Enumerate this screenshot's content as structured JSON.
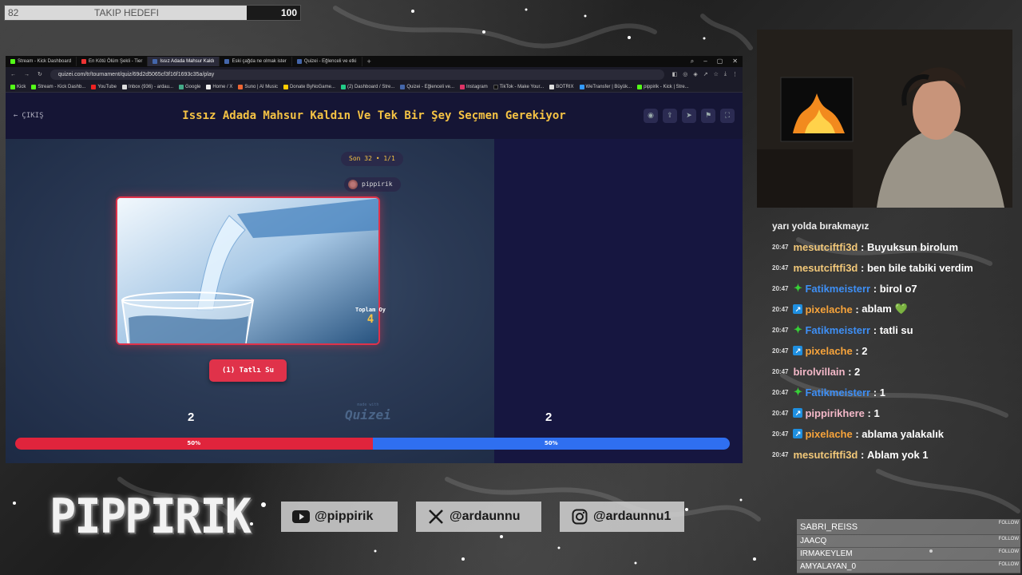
{
  "goal": {
    "current": "82",
    "label": "TAKIP HEDEFI",
    "max": "100",
    "progress": 0.82
  },
  "browser": {
    "tabs": [
      "Stream - Kick Dashboard",
      "En Kötü Ölüm Şekli - Tier",
      "Issız Adada Mahsur Kaldı",
      "Eski çağda ne olmak ister",
      "Quizei - Eğlenceli ve etki"
    ],
    "url": "quizei.com/tr/tournament/quiz/69d2d5065cf3f16f1693c35a/play",
    "bookmarks": [
      "Kick",
      "Stream - Kick Dashb...",
      "YouTube",
      "Inbox (936) - ardau...",
      "Google",
      "Home / X",
      "Suno | AI Music",
      "Donate ByNoGame...",
      "(2) Dashboard / Stre...",
      "Quizei - Eğlenceli ve...",
      "Instagram",
      "TikTok - Make Your...",
      "BOTRIX",
      "WeTransfer | Büyük...",
      "pippirik - Kick | Stre..."
    ]
  },
  "quiz": {
    "back_label": "ÇIKIŞ",
    "title": "Issız Adada Mahsur Kaldın Ve Tek Bir Şey Seçmen Gerekiyor",
    "round": "Son 32 • 1/1",
    "creator": "pippirik",
    "total_votes_label": "Toplam Oy",
    "total_votes": "4",
    "choice_label": "(1) Tatlı Su",
    "made_with": "made with",
    "brand": "Quizei",
    "left_count": "2",
    "right_count": "2",
    "left_percent": "50%",
    "right_percent": "50%"
  },
  "chat": {
    "cut_line": "yarı yolda bırakmayız",
    "messages": [
      {
        "time": "20:47",
        "badge": "",
        "user": "mesutciftfi3d",
        "color": "#f2c879",
        "text": "Buyuksun birolum"
      },
      {
        "time": "20:47",
        "badge": "",
        "user": "mesutciftfi3d",
        "color": "#f2c879",
        "text": "ben bile tabiki verdim"
      },
      {
        "time": "20:47",
        "badge": "green",
        "user": "Fatikmeisterr",
        "color": "#3e8ff5",
        "text": "birol o7"
      },
      {
        "time": "20:47",
        "badge": "blue",
        "user": "pixelache",
        "color": "#f6a33b",
        "text": "ablam 💚"
      },
      {
        "time": "20:47",
        "badge": "green",
        "user": "Fatikmeisterr",
        "color": "#3e8ff5",
        "text": "tatli su"
      },
      {
        "time": "20:47",
        "badge": "blue",
        "user": "pixelache",
        "color": "#f6a33b",
        "text": "2"
      },
      {
        "time": "20:47",
        "badge": "",
        "user": "birolvillain",
        "color": "#f3b8c8",
        "text": "2"
      },
      {
        "time": "20:47",
        "badge": "green",
        "user": "Fatikmeisterr",
        "color": "#3e8ff5",
        "text": "1"
      },
      {
        "time": "20:47",
        "badge": "blue",
        "user": "pippirikhere",
        "color": "#f3b8c8",
        "text": "1"
      },
      {
        "time": "20:47",
        "badge": "blue",
        "user": "pixelache",
        "color": "#f6a33b",
        "text": "ablama yalakalık"
      },
      {
        "time": "20:47",
        "badge": "",
        "user": "mesutciftfi3d",
        "color": "#f2c879",
        "text": "Ablam yok 1"
      }
    ]
  },
  "logo": "PIPPIRIK",
  "socials": [
    {
      "icon": "youtube-icon",
      "handle": "@pippirik"
    },
    {
      "icon": "x-icon",
      "handle": "@ardaunnu"
    },
    {
      "icon": "instagram-icon",
      "handle": "@ardaunnu1"
    }
  ],
  "followers": {
    "tag": "FOLLOW",
    "names": [
      "SABRI_REISS",
      "JAACQ",
      "IRMAKEYLEM",
      "AMYALAYAN_0"
    ]
  }
}
